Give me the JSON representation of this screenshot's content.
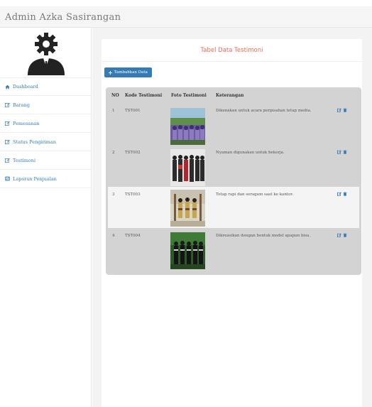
{
  "app": {
    "title": "Admin Azka Sasirangan"
  },
  "sidebar": {
    "items": [
      {
        "label": "Dashboard",
        "icon": "home-icon"
      },
      {
        "label": "Barang",
        "icon": "edit-icon"
      },
      {
        "label": "Pemesanan",
        "icon": "edit-icon"
      },
      {
        "label": "Status Pengiriman",
        "icon": "edit-icon"
      },
      {
        "label": "Testimoni",
        "icon": "edit-icon"
      },
      {
        "label": "Laporan Penjualan",
        "icon": "report-icon"
      }
    ]
  },
  "main": {
    "title": "Tabel Data Testimoni",
    "add_button": "Tambahkan Data",
    "table": {
      "headers": [
        "NO",
        "Kode Testimoni",
        "Foto Testimoni",
        "Keterangan"
      ],
      "rows": [
        {
          "no": "1",
          "kode": "TST001",
          "keterangan": "Dikenakan untuk acara perpisahan tetap media."
        },
        {
          "no": "2",
          "kode": "TST002",
          "keterangan": "Nyaman digunakan untuk bekerja."
        },
        {
          "no": "3",
          "kode": "TST003",
          "keterangan": "Tetap rapi dan seragam saat ke kantor."
        },
        {
          "no": "4",
          "kode": "TST004",
          "keterangan": "Dikreasikan dengan bentuk model apapun bisa."
        }
      ],
      "action_separator": "| |"
    }
  },
  "colors": {
    "accent": "#337ab7",
    "title": "#e0705a",
    "table_bg": "#d3d3d3",
    "row_highlight": "#f4f4f4"
  }
}
